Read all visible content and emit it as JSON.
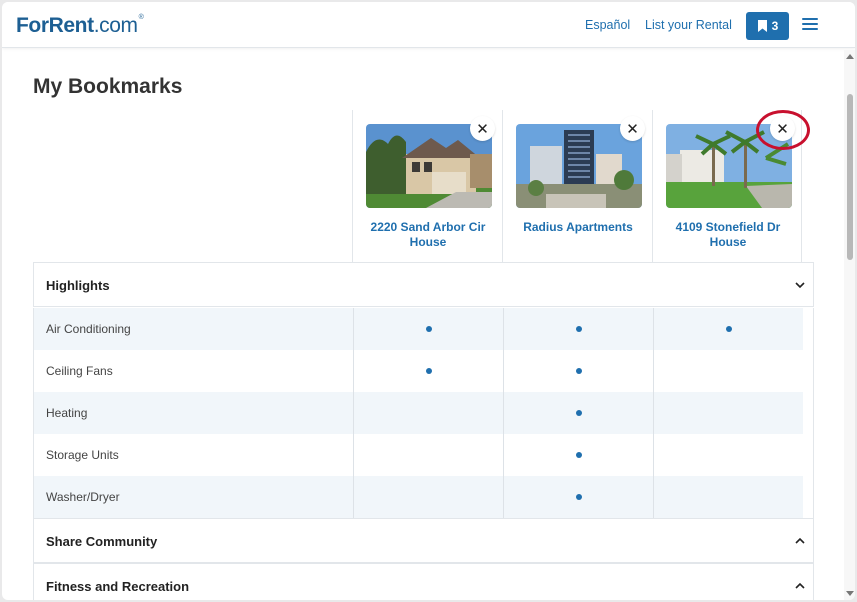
{
  "header": {
    "logo_main": "ForRent",
    "logo_dotcom": ".com",
    "logo_reg": "®",
    "espanol": "Español",
    "list_rental": "List your Rental",
    "bookmark_count": "3",
    "bookmark_icon": "bookmark-icon",
    "menu_icon": "hamburger-menu-icon"
  },
  "page": {
    "title": "My Bookmarks"
  },
  "properties": [
    {
      "name_line1": "2220 Sand Arbor Cir",
      "name_line2": "House",
      "remove_label": "✕"
    },
    {
      "name_line1": "Radius Apartments",
      "name_line2": "",
      "remove_label": "✕"
    },
    {
      "name_line1": "4109 Stonefield Dr",
      "name_line2": "House",
      "remove_label": "✕"
    }
  ],
  "sections": {
    "highlights": "Highlights",
    "share_community": "Share Community",
    "fitness": "Fitness and Recreation"
  },
  "rows": [
    {
      "label": "Air Conditioning",
      "values": [
        true,
        true,
        true
      ]
    },
    {
      "label": "Ceiling Fans",
      "values": [
        true,
        true,
        false
      ]
    },
    {
      "label": "Heating",
      "values": [
        false,
        true,
        false
      ]
    },
    {
      "label": "Storage Units",
      "values": [
        false,
        true,
        false
      ]
    },
    {
      "label": "Washer/Dryer",
      "values": [
        false,
        true,
        false
      ]
    }
  ],
  "colors": {
    "brand": "#1d5f93",
    "accent": "#1f6fae",
    "annotation": "#c8102e",
    "row_alt": "#f1f6fa"
  }
}
